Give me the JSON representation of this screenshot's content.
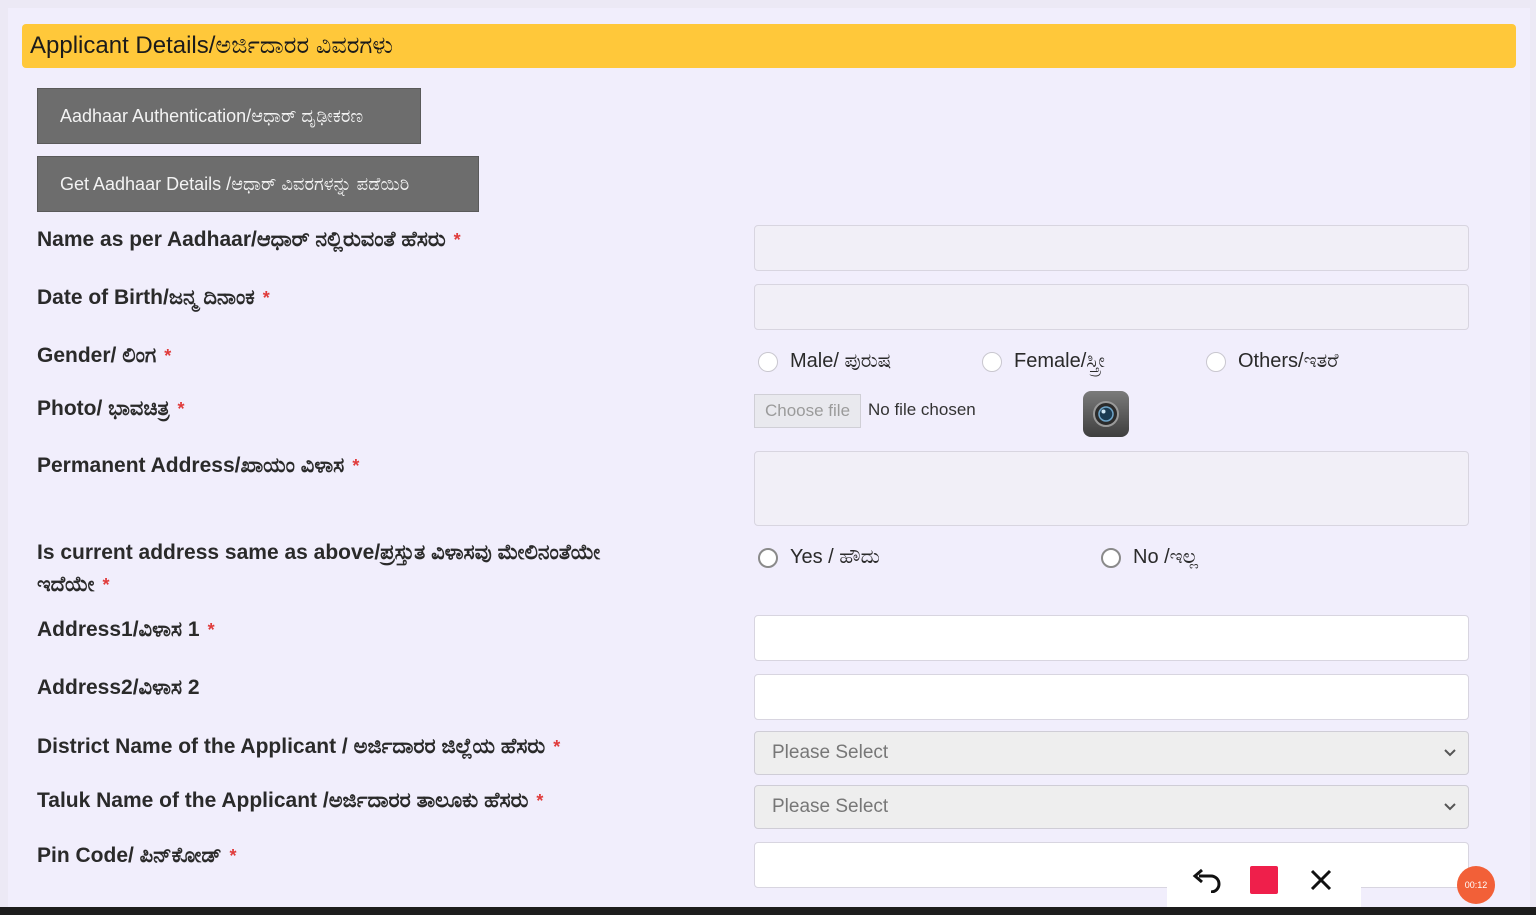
{
  "section": {
    "title": "Applicant Details/ಅರ್ಜಿದಾರರ ವಿವರಗಳು"
  },
  "buttons": {
    "aadhaar_auth": "Aadhaar Authentication/ಆಧಾರ್ ದೃಢೀಕರಣ",
    "get_aadhaar": "Get Aadhaar Details /ಆಧಾರ್ ವಿವರಗಳನ್ನು ಪಡೆಯಿರಿ"
  },
  "fields": {
    "name": {
      "label": "Name as per Aadhaar/ಆಧಾರ್ ನಲ್ಲಿರುವಂತೆ ಹೆಸರು",
      "required": "*"
    },
    "dob": {
      "label": "Date of Birth/ಜನ್ಮ ದಿನಾಂಕ",
      "required": "*"
    },
    "gender": {
      "label": "Gender/ ಲಿಂಗ",
      "required": "*",
      "options": [
        "Male/ ಪುರುಷ",
        "Female/ಸ್ತ್ರೀ",
        "Others/ಇತರೆ"
      ]
    },
    "photo": {
      "label": "Photo/ ಭಾವಚಿತ್ರ",
      "required": "*",
      "choose": "Choose file",
      "status": "No file chosen"
    },
    "perm_address": {
      "label": "Permanent Address/ಖಾಯಂ ವಿಳಾಸ",
      "required": "*"
    },
    "same_address": {
      "label_line1": "Is current address same as above/ಪ್ರಸ್ತುತ ವಿಳಾಸವು ಮೇಲಿನಂತೆಯೇ",
      "label_line2": "ಇದೆಯೇ",
      "required": "*",
      "options": [
        "Yes / ಹೌದು",
        "No /ಇಲ್ಲ"
      ]
    },
    "address1": {
      "label": "Address1/ವಿಳಾಸ 1",
      "required": "*"
    },
    "address2": {
      "label": "Address2/ವಿಳಾಸ 2"
    },
    "district": {
      "label": "District Name of the Applicant / ಅರ್ಜಿದಾರರ ಜಿಲ್ಲೆಯ ಹೆಸರು",
      "required": "*",
      "value": "Please Select"
    },
    "taluk": {
      "label": "Taluk Name of the Applicant /ಅರ್ಜಿದಾರರ ತಾಲೂಕು ಹೆಸರು",
      "required": "*",
      "value": "Please Select"
    },
    "pincode": {
      "label": "Pin Code/ ಪಿನ್‌ಕೋಡ್",
      "required": "*"
    }
  },
  "recorder": {
    "badge": "00:12"
  },
  "colors": {
    "header": "#ffc83a",
    "button": "#6d6d6d",
    "required": "#e03a3a",
    "stop": "#ef1f4b"
  },
  "icons": {
    "camera": "camera-icon",
    "undo": "undo-icon",
    "stop": "stop-icon",
    "close": "close-icon",
    "chevron": "chevron-down-icon"
  }
}
